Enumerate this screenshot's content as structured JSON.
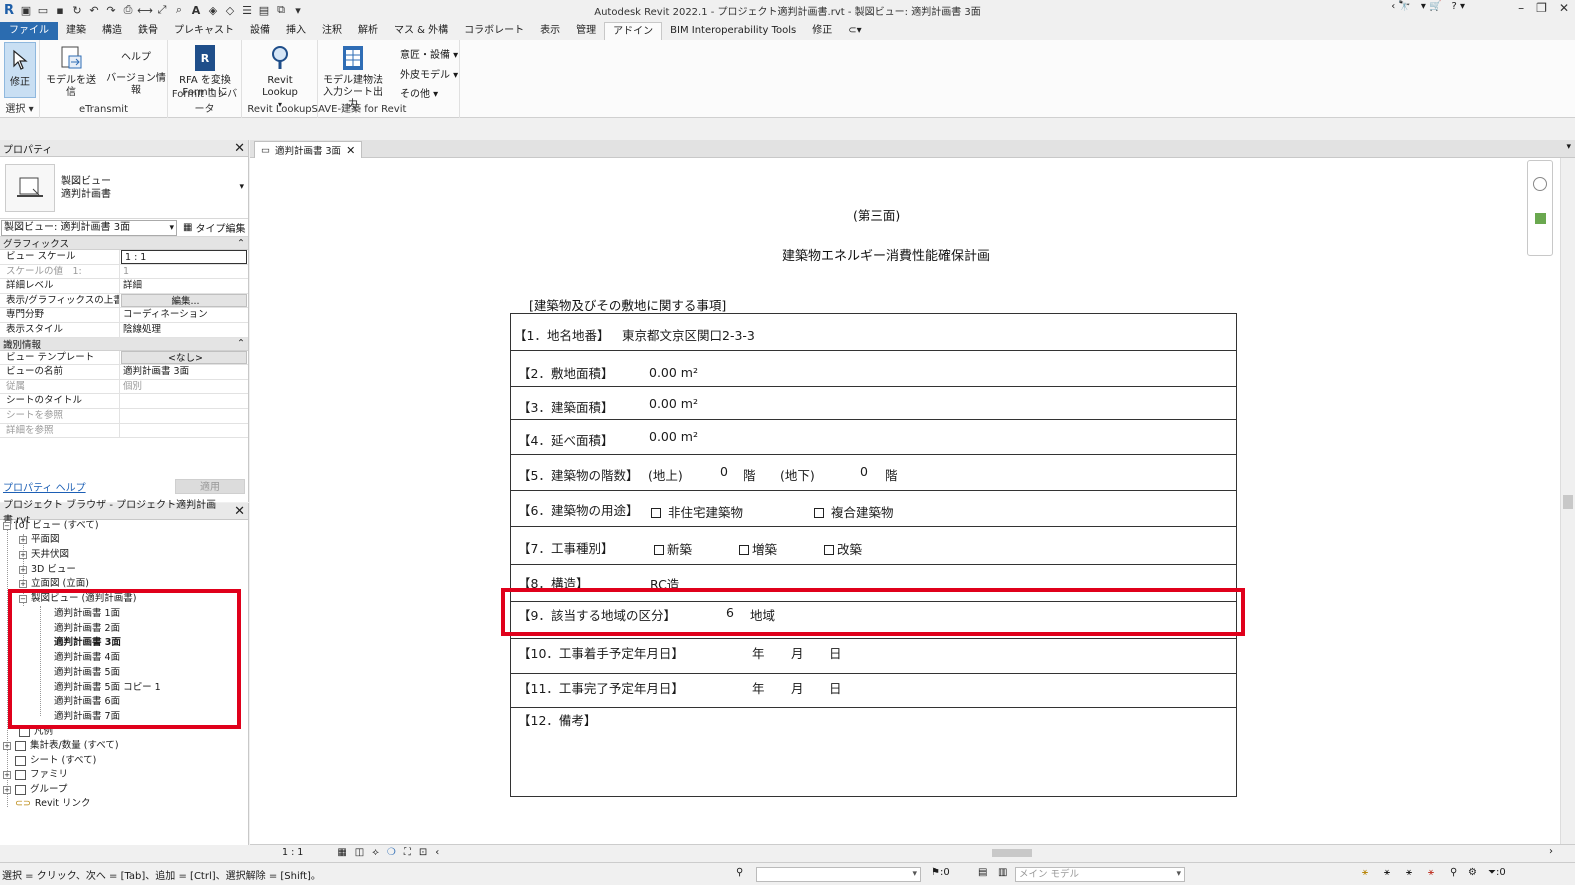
{
  "app": {
    "title": "Autodesk Revit 2022.1 - プロジェクト適判計画書.rvt - 製図ビュー: 適判計画書 3面"
  },
  "menu": {
    "file": "ファイル",
    "tabs": [
      "建築",
      "構造",
      "鉄骨",
      "プレキャスト",
      "設備",
      "挿入",
      "注釈",
      "解析",
      "マス & 外構",
      "コラボレート",
      "表示",
      "管理",
      "アドイン",
      "BIM Interoperability Tools",
      "修正"
    ],
    "active_index": 12
  },
  "ribbon": {
    "modify": "修正",
    "select": "選択",
    "send_model": "モデルを送信",
    "help": "ヘルプ",
    "version_info": "バージョン情報",
    "etransmit": "eTransmit",
    "rfa_line1": "RFA を変換",
    "rfa_line2": "FormIt に",
    "formit_panel": "FormIt コンバータ",
    "revit_lookup": "Revit Lookup",
    "revit_lookup_panel": "Revit Lookup",
    "save_line1": "モデル建物法",
    "save_line2": "入力シート出力",
    "save_panel": "SAVE-建築 for Revit",
    "side1": "意匠・設備",
    "side2": "外皮モデル",
    "side3": "その他"
  },
  "properties": {
    "title": "プロパティ",
    "type_line1": "製図ビュー",
    "type_line2": "適判計画書",
    "instance": "製図ビュー: 適判計画書 3面",
    "type_edit": "タイプ編集",
    "cat_graphics": "グラフィックス",
    "cat_identity": "識別情報",
    "rows_graphics": [
      {
        "k": "ビュー スケール",
        "v": "1 : 1"
      },
      {
        "k": "スケールの値　1:",
        "v": "1"
      },
      {
        "k": "詳細レベル",
        "v": "詳細"
      },
      {
        "k": "表示/グラフィックスの上書き",
        "v": "編集..."
      },
      {
        "k": "専門分野",
        "v": "コーディネーション"
      },
      {
        "k": "表示スタイル",
        "v": "陰線処理"
      }
    ],
    "rows_identity": [
      {
        "k": "ビュー テンプレート",
        "v": "<なし>"
      },
      {
        "k": "ビューの名前",
        "v": "適判計画書 3面"
      },
      {
        "k": "従属",
        "v": "個別"
      },
      {
        "k": "シートのタイトル",
        "v": ""
      },
      {
        "k": "シートを参照",
        "v": ""
      },
      {
        "k": "詳細を参照",
        "v": ""
      }
    ],
    "help_link": "プロパティ ヘルプ",
    "apply": "適用"
  },
  "browser": {
    "title": "プロジェクト ブラウザ - プロジェクト適判計画書.rvt",
    "views_all": "ビュー (すべて)",
    "plan": "平面図",
    "ceiling": "天井伏図",
    "view3d": "3D ビュー",
    "elevation": "立面図 (立面)",
    "drafting": "製図ビュー (適判計画書)",
    "sheets": [
      "適判計画書 1面",
      "適判計画書 2面",
      "適判計画書 3面",
      "適判計画書 4面",
      "適判計画書 5面",
      "適判計画書 5面 コピー 1",
      "適判計画書 6面",
      "適判計画書 7面"
    ],
    "legend": "凡例",
    "schedules": "集計表/数量 (すべて)",
    "sheets_all": "シート (すべて)",
    "families": "ファミリ",
    "groups": "グループ",
    "links": "Revit リンク"
  },
  "view": {
    "tab": "適判計画書 3面",
    "page_label": "(第三面)",
    "doc_title": "建築物エネルギー消費性能確保計画",
    "section": "[建築物及びその敷地に関する事項]",
    "r1_label": "【1．地名地番】",
    "r1_value": "東京都文京区関口2-3-3",
    "r2_label": "【2．敷地面積】",
    "r2_value": "0.00 m²",
    "r3_label": "【3．建築面積】",
    "r3_value": "0.00 m²",
    "r4_label": "【4．延べ面積】",
    "r4_value": "0.00 m²",
    "r5_label": "【5．建築物の階数】",
    "r5_above": "(地上)",
    "r5_above_n": "0",
    "r5_kai1": "階",
    "r5_below": "(地下)",
    "r5_below_n": "0",
    "r5_kai2": "階",
    "r6_label": "【6．建築物の用途】",
    "r6_opt1": "非住宅建築物",
    "r6_opt2": "複合建築物",
    "r7_label": "【7．工事種別】",
    "r7_opt1": "新築",
    "r7_opt2": "増築",
    "r7_opt3": "改築",
    "r8_label": "【8．構造】",
    "r8_value": "RC造",
    "r9_label": "【9．該当する地域の区分】",
    "r9_num": "6",
    "r9_unit": "地域",
    "r10_label": "【10．工事着手予定年月日】",
    "r11_label": "【11．工事完了予定年月日】",
    "year": "年",
    "month": "月",
    "day": "日",
    "r12_label": "【12．備考】",
    "scale": "1 : 1"
  },
  "status": {
    "message": "選択 = クリック、次へ = [Tab]、追加 = [Ctrl]、選択解除 = [Shift]。",
    "zero": ":0",
    "model": "メイン モデル",
    "filter_zero": ":0"
  }
}
